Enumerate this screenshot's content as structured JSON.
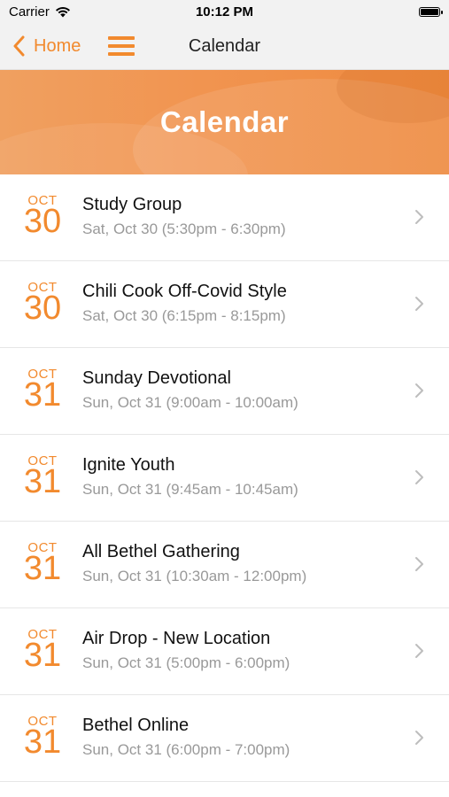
{
  "status_bar": {
    "carrier": "Carrier",
    "time": "10:12 PM",
    "wifi_icon": "wifi-icon",
    "battery_icon": "battery-icon"
  },
  "nav": {
    "back_label": "Home",
    "back_icon": "chevron-left-icon",
    "menu_icon": "hamburger-menu-icon",
    "title": "Calendar"
  },
  "banner": {
    "title": "Calendar"
  },
  "colors": {
    "accent": "#f28a2e",
    "subtext": "#999999",
    "divider": "#e6e6e6"
  },
  "events": [
    {
      "month": "OCT",
      "day": "30",
      "title": "Study Group",
      "subtitle": "Sat, Oct 30 (5:30pm - 6:30pm)"
    },
    {
      "month": "OCT",
      "day": "30",
      "title": "Chili Cook Off-Covid Style",
      "subtitle": "Sat, Oct 30 (6:15pm - 8:15pm)"
    },
    {
      "month": "OCT",
      "day": "31",
      "title": "Sunday Devotional",
      "subtitle": "Sun, Oct 31 (9:00am - 10:00am)"
    },
    {
      "month": "OCT",
      "day": "31",
      "title": "Ignite Youth",
      "subtitle": "Sun, Oct 31 (9:45am - 10:45am)"
    },
    {
      "month": "OCT",
      "day": "31",
      "title": "All Bethel Gathering",
      "subtitle": "Sun, Oct 31 (10:30am - 12:00pm)"
    },
    {
      "month": "OCT",
      "day": "31",
      "title": "Air Drop - New Location",
      "subtitle": "Sun, Oct 31 (5:00pm - 6:00pm)"
    },
    {
      "month": "OCT",
      "day": "31",
      "title": "Bethel Online",
      "subtitle": "Sun, Oct 31 (6:00pm - 7:00pm)"
    }
  ]
}
